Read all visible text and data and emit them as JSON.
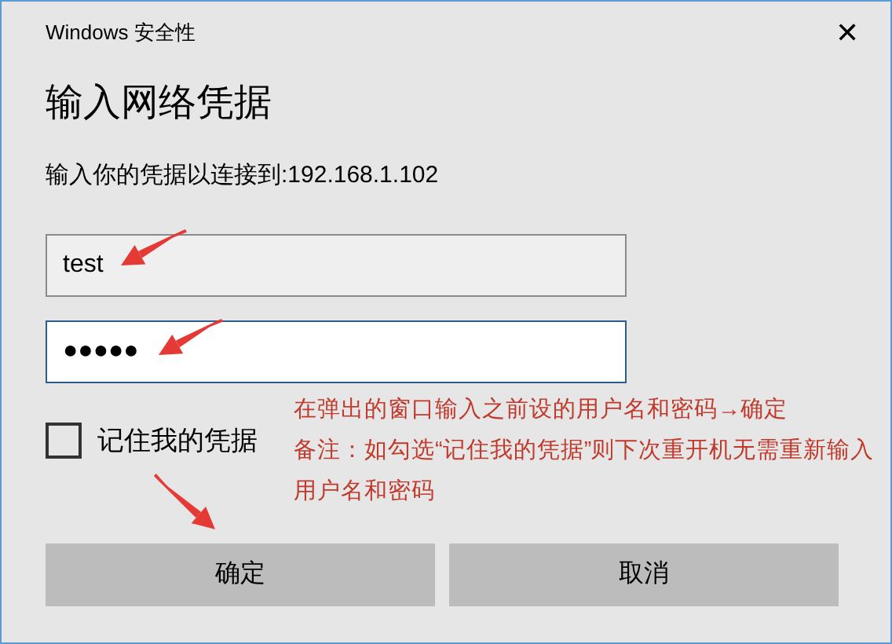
{
  "window": {
    "title": "Windows 安全性",
    "close": "✕"
  },
  "heading": "输入网络凭据",
  "prompt": "输入你的凭据以连接到:192.168.1.102",
  "username": {
    "value": "test"
  },
  "password": {
    "value": "●●●●●",
    "focused": true
  },
  "remember": {
    "label": "记住我的凭据",
    "checked": false
  },
  "annotations": [
    "在弹出的窗口输入之前设的用户名和密码→确定",
    "备注：如勾选“记住我的凭据”则下次重开机无需重新输入用户名和密码"
  ],
  "buttons": [
    {
      "label": "确定"
    },
    {
      "label": "取消"
    }
  ]
}
